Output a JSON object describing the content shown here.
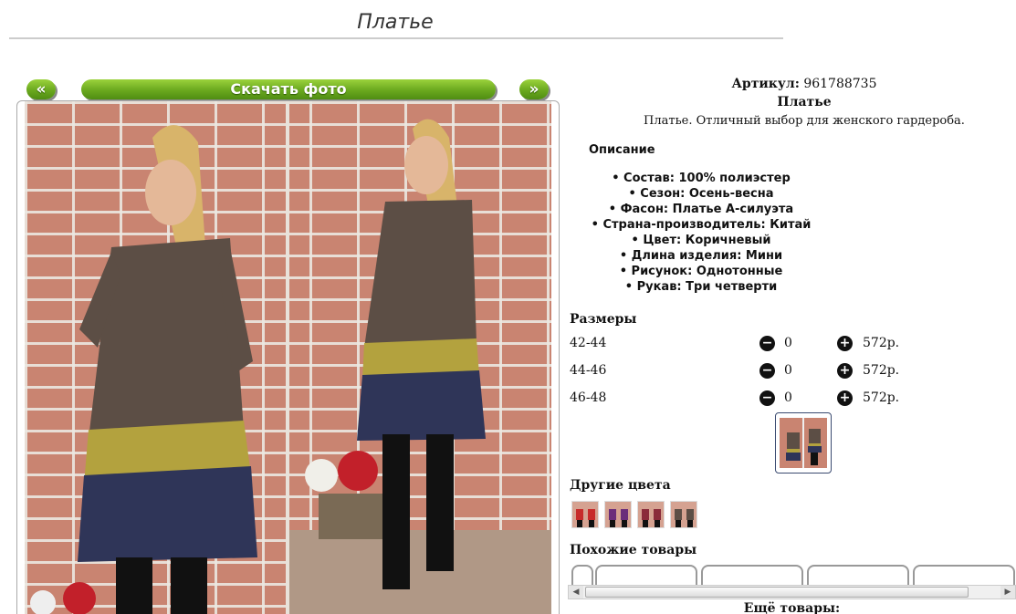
{
  "page": {
    "title": "Платье"
  },
  "gallery": {
    "prev_label": "«",
    "download_label": "Скачать фото",
    "next_label": "»"
  },
  "product": {
    "article_label": "Артикул:",
    "article_value": "961788735",
    "name": "Платье",
    "short_description": "Платье. Отличный выбор для женского гардероба.",
    "description_title": "Описание",
    "attributes": [
      "Состав: 100% полиэстер",
      "Сезон: Осень-весна",
      "Фасон: Платье А-силуэта",
      "Страна-производитель: Китай",
      "Цвет: Коричневый",
      "Длина изделия: Мини",
      "Рисунок: Однотонные",
      "Рукав: Три четверти"
    ]
  },
  "sizes": {
    "title": "Размеры",
    "rows": [
      {
        "size": "42-44",
        "qty": "0",
        "price": "572р."
      },
      {
        "size": "44-46",
        "qty": "0",
        "price": "572р."
      },
      {
        "size": "46-48",
        "qty": "0",
        "price": "572р."
      }
    ]
  },
  "other_colors": {
    "title": "Другие цвета"
  },
  "similar": {
    "title": "Похожие товары",
    "more_label": "Ещё товары:"
  },
  "colors": {
    "accent_green": "#6aa81e",
    "brick": "#c98471",
    "dress_brown": "#5c4e45",
    "dress_mustard": "#b3a23e",
    "dress_navy": "#2f3558"
  }
}
